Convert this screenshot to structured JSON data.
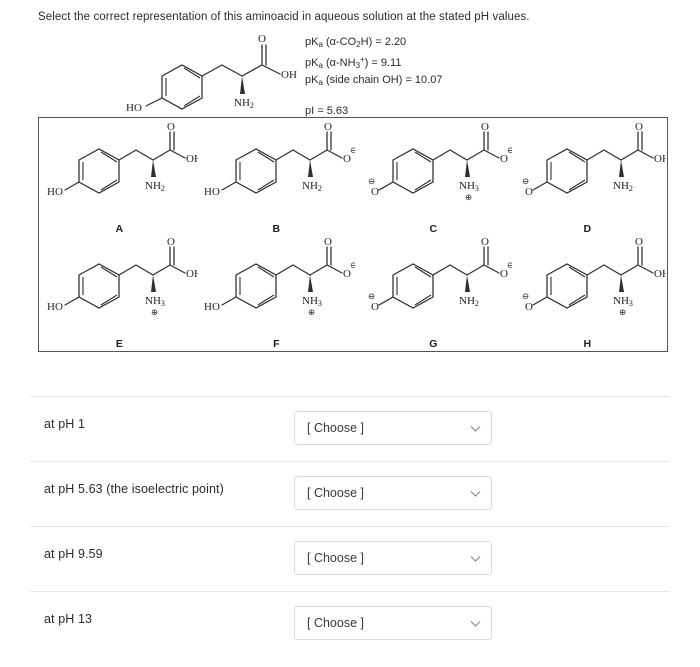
{
  "prompt": "Select the correct representation of this aminoacid in aqueous solution at the stated pH values.",
  "constants": {
    "pka_carboxyl": "pK",
    "pka_carboxyl_line": "pKa (α-CO2H) = 2.20",
    "pka_amino_line": "pKa (α-NH3+) = 9.11",
    "pka_sidechain_line": "pKa (side chain OH) = 10.07",
    "pi_line": "pI = 5.63",
    "pka_label": "pK",
    "pka_sub": "a",
    "carboxyl_group": "(α-CO",
    "carboxyl_sub": "2",
    "carboxyl_tail": "H) = 2.20",
    "amino_group": "(α-NH",
    "amino_sub": "3",
    "amino_sup": "+",
    "amino_tail": ") = 9.11",
    "sidechain_group": "(side chain OH) = 10.07",
    "pi_text": "pI = 5.63"
  },
  "reference_molecule": {
    "name": "tyrosine-neutral",
    "phenol_label": "HO",
    "carbonyl_label": "O",
    "acid_label": "OH",
    "amine_label": "NH",
    "amine_sub": "2"
  },
  "options": [
    {
      "letter": "A",
      "name": "option-a",
      "phenol": "HO",
      "phenol_charge": "",
      "carbonyl": "O",
      "acid": "OH",
      "acid_charge": "",
      "amine": "NH",
      "amine_sub": "2",
      "amine_charge": ""
    },
    {
      "letter": "B",
      "name": "option-b",
      "phenol": "HO",
      "phenol_charge": "",
      "carbonyl": "O",
      "acid": "O",
      "acid_charge": "⊖",
      "amine": "NH",
      "amine_sub": "2",
      "amine_charge": ""
    },
    {
      "letter": "C",
      "name": "option-c",
      "phenol": "O",
      "phenol_charge": "⊖",
      "carbonyl": "O",
      "acid": "O",
      "acid_charge": "⊖",
      "amine": "NH",
      "amine_sub": "3",
      "amine_charge": "⊕"
    },
    {
      "letter": "D",
      "name": "option-d",
      "phenol": "O",
      "phenol_charge": "⊖",
      "carbonyl": "O",
      "acid": "OH",
      "acid_charge": "",
      "amine": "NH",
      "amine_sub": "2",
      "amine_charge": ""
    },
    {
      "letter": "E",
      "name": "option-e",
      "phenol": "HO",
      "phenol_charge": "",
      "carbonyl": "O",
      "acid": "OH",
      "acid_charge": "",
      "amine": "NH",
      "amine_sub": "3",
      "amine_charge": "⊕"
    },
    {
      "letter": "F",
      "name": "option-f",
      "phenol": "HO",
      "phenol_charge": "",
      "carbonyl": "O",
      "acid": "O",
      "acid_charge": "⊖",
      "amine": "NH",
      "amine_sub": "3",
      "amine_charge": "⊕"
    },
    {
      "letter": "G",
      "name": "option-g",
      "phenol": "O",
      "phenol_charge": "⊖",
      "carbonyl": "O",
      "acid": "O",
      "acid_charge": "⊖",
      "amine": "NH",
      "amine_sub": "2",
      "amine_charge": ""
    },
    {
      "letter": "H",
      "name": "option-h",
      "phenol": "O",
      "phenol_charge": "⊖",
      "carbonyl": "O",
      "acid": "OH",
      "acid_charge": "",
      "amine": "NH",
      "amine_sub": "3",
      "amine_charge": "⊕"
    }
  ],
  "answer_rows": [
    {
      "label": "at pH 1",
      "value": "[ Choose ]"
    },
    {
      "label": "at pH 5.63 (the isoelectric point)",
      "value": "[ Choose ]"
    },
    {
      "label": "at pH 9.59",
      "value": "[ Choose ]"
    },
    {
      "label": "at pH 13",
      "value": "[ Choose ]"
    }
  ],
  "colors": {
    "text": "#2b2b2b",
    "box_border": "#555555",
    "row_divider": "#e6e6e6",
    "select_border": "#dcdcdc",
    "bond": "#2f2f2f"
  }
}
